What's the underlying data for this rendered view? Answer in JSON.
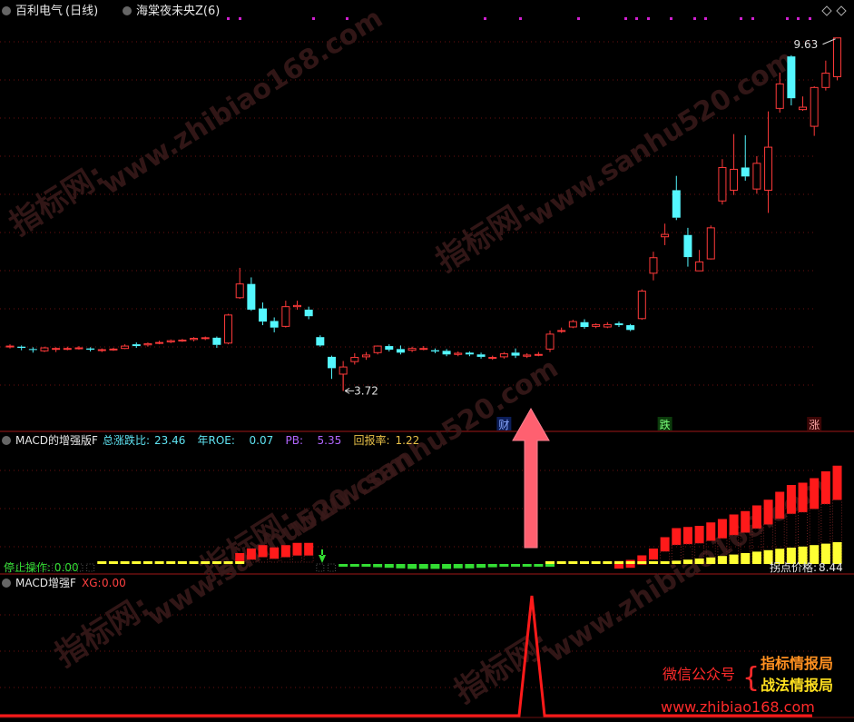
{
  "panel1": {
    "stock_name": "百利电气",
    "period": "(日线)",
    "indicator_name": "海棠夜未央Z(6)",
    "high_label": "9.63",
    "low_label": "3.72",
    "markers": [
      "财",
      "跌",
      "涨"
    ]
  },
  "panel2": {
    "indicator_name": "MACD的增强版F",
    "stats": [
      {
        "label": "总涨跌比:",
        "value": "23.46",
        "color": "#5fe3f2"
      },
      {
        "label": "年ROE:",
        "value": "0.07",
        "color": "#5fe3f2"
      },
      {
        "label": "PB:",
        "value": "5.35",
        "color": "#b266ff"
      },
      {
        "label": "回报率:",
        "value": "1.22",
        "color": "#e8c048"
      }
    ],
    "status_text": "停止操作: 0.00",
    "turning_price_label": "拐点价格:",
    "turning_price_value": "8.44"
  },
  "panel3": {
    "indicator_name": "MACD增强F",
    "xg_label": "XG:",
    "xg_value": "0.00"
  },
  "footer": {
    "wechat_label": "微信公众号",
    "brace": "{",
    "line1": "指标情报局",
    "line2": "战法情报局",
    "url": "www.zhibiao168.com"
  },
  "colors": {
    "up": "#ff3a3a",
    "down": "#54f7ff",
    "bar_red": "#ff1a1a",
    "bar_yellow": "#ffff33",
    "bar_green": "#33dd33",
    "divider": "#a01818",
    "arrow": "#ff6070",
    "marker_dot": "#d020d0"
  },
  "chart_data": [
    {
      "type": "candlestick",
      "candles": [
        [
          4.46,
          4.47,
          4.43,
          4.5
        ],
        [
          4.46,
          4.44,
          4.4,
          4.48
        ],
        [
          4.42,
          4.41,
          4.36,
          4.45
        ],
        [
          4.39,
          4.44,
          4.37,
          4.46
        ],
        [
          4.42,
          4.43,
          4.37,
          4.45
        ],
        [
          4.43,
          4.43,
          4.4,
          4.46
        ],
        [
          4.44,
          4.44,
          4.41,
          4.47
        ],
        [
          4.43,
          4.41,
          4.38,
          4.45
        ],
        [
          4.4,
          4.41,
          4.37,
          4.43
        ],
        [
          4.41,
          4.42,
          4.39,
          4.44
        ],
        [
          4.43,
          4.47,
          4.42,
          4.5
        ],
        [
          4.5,
          4.47,
          4.44,
          4.53
        ],
        [
          4.49,
          4.51,
          4.46,
          4.53
        ],
        [
          4.52,
          4.53,
          4.5,
          4.56
        ],
        [
          4.54,
          4.56,
          4.52,
          4.58
        ],
        [
          4.57,
          4.57,
          4.54,
          4.59
        ],
        [
          4.58,
          4.6,
          4.55,
          4.62
        ],
        [
          4.6,
          4.61,
          4.57,
          4.63
        ],
        [
          4.61,
          4.49,
          4.44,
          4.63
        ],
        [
          4.52,
          4.99,
          4.5,
          5.01
        ],
        [
          5.28,
          5.51,
          5.26,
          5.78
        ],
        [
          5.51,
          5.08,
          5.06,
          5.62
        ],
        [
          5.1,
          4.88,
          4.82,
          5.2
        ],
        [
          4.89,
          4.78,
          4.7,
          4.95
        ],
        [
          4.8,
          5.13,
          4.78,
          5.23
        ],
        [
          5.13,
          5.15,
          5.08,
          5.23
        ],
        [
          5.08,
          4.97,
          4.92,
          5.13
        ],
        [
          4.62,
          4.48,
          4.46,
          4.65
        ],
        [
          4.29,
          4.1,
          3.92,
          4.31
        ],
        [
          4.0,
          4.12,
          3.72,
          4.22
        ],
        [
          4.21,
          4.28,
          4.16,
          4.35
        ],
        [
          4.29,
          4.32,
          4.24,
          4.37
        ],
        [
          4.36,
          4.47,
          4.33,
          4.48
        ],
        [
          4.47,
          4.41,
          4.38,
          4.5
        ],
        [
          4.42,
          4.36,
          4.33,
          4.48
        ],
        [
          4.4,
          4.43,
          4.37,
          4.46
        ],
        [
          4.43,
          4.43,
          4.4,
          4.47
        ],
        [
          4.4,
          4.38,
          4.35,
          4.43
        ],
        [
          4.39,
          4.33,
          4.3,
          4.42
        ],
        [
          4.33,
          4.35,
          4.3,
          4.38
        ],
        [
          4.36,
          4.33,
          4.3,
          4.38
        ],
        [
          4.33,
          4.29,
          4.26,
          4.36
        ],
        [
          4.28,
          4.28,
          4.24,
          4.31
        ],
        [
          4.29,
          4.34,
          4.26,
          4.37
        ],
        [
          4.36,
          4.31,
          4.27,
          4.43
        ],
        [
          4.3,
          4.32,
          4.27,
          4.35
        ],
        [
          4.33,
          4.33,
          4.3,
          4.37
        ],
        [
          4.42,
          4.67,
          4.37,
          4.73
        ],
        [
          4.72,
          4.73,
          4.69,
          4.78
        ],
        [
          4.79,
          4.88,
          4.77,
          4.91
        ],
        [
          4.87,
          4.79,
          4.76,
          4.92
        ],
        [
          4.8,
          4.83,
          4.77,
          4.85
        ],
        [
          4.79,
          4.83,
          4.77,
          4.87
        ],
        [
          4.85,
          4.82,
          4.79,
          4.88
        ],
        [
          4.82,
          4.74,
          4.72,
          4.84
        ],
        [
          4.93,
          5.39,
          4.91,
          5.42
        ],
        [
          5.69,
          5.95,
          5.57,
          6.05
        ],
        [
          6.3,
          6.34,
          6.16,
          6.52
        ],
        [
          7.08,
          6.62,
          6.58,
          7.32
        ],
        [
          6.33,
          5.96,
          5.8,
          6.45
        ],
        [
          5.73,
          5.88,
          5.81,
          6.08
        ],
        [
          5.93,
          6.45,
          5.92,
          6.49
        ],
        [
          6.9,
          7.46,
          6.84,
          7.6
        ],
        [
          7.08,
          7.43,
          7.0,
          8.02
        ],
        [
          7.46,
          7.31,
          7.24,
          8.0
        ],
        [
          7.1,
          7.53,
          7.02,
          7.65
        ],
        [
          7.08,
          7.8,
          6.7,
          8.4
        ],
        [
          8.45,
          8.86,
          8.38,
          9.05
        ],
        [
          9.32,
          8.62,
          8.5,
          9.34
        ],
        [
          8.43,
          8.47,
          8.41,
          8.65
        ],
        [
          8.15,
          8.8,
          7.99,
          8.82
        ],
        [
          8.8,
          9.04,
          8.75,
          9.25
        ],
        [
          8.98,
          9.63,
          8.92,
          9.63
        ]
      ],
      "ylim": [
        3.3,
        9.9
      ],
      "annotations": [
        {
          "text": "9.63",
          "candle": 72,
          "price": 9.63
        },
        {
          "text": "3.72",
          "candle": 29,
          "price": 3.72
        },
        {
          "text": "财",
          "candle": 43
        },
        {
          "text": "跌",
          "candle": 57
        },
        {
          "text": "涨",
          "candle": 70
        }
      ]
    },
    {
      "type": "bar",
      "series": [
        {
          "name": "red_bars",
          "values": [
            0,
            0,
            0,
            0,
            0,
            0,
            0,
            0,
            0,
            0,
            0,
            0,
            0,
            0,
            0,
            0,
            0,
            0,
            0,
            0,
            0.08,
            0.12,
            0.15,
            0.13,
            0.15,
            0.17,
            0.17,
            0,
            0,
            0,
            0,
            0,
            0,
            0,
            0,
            0,
            0,
            0,
            0,
            0,
            0,
            0,
            0,
            0,
            0,
            0,
            0,
            0,
            0,
            0,
            0,
            0,
            0,
            0.01,
            0.02,
            0.06,
            0.12,
            0.22,
            0.3,
            0.31,
            0.32,
            0.35,
            0.38,
            0.42,
            0.45,
            0.5,
            0.55,
            0.62,
            0.68,
            0.7,
            0.74,
            0.8,
            0.85,
            0.95
          ]
        },
        {
          "name": "yellow_bars",
          "values": [
            0,
            0,
            0,
            0,
            0,
            0,
            0,
            0,
            0.02,
            0.02,
            0.02,
            0.02,
            0.02,
            0.02,
            0.02,
            0.02,
            0.02,
            0.02,
            0.02,
            0.02,
            0.02,
            0,
            0,
            0,
            0,
            0,
            0,
            0,
            0,
            0,
            0,
            0,
            0,
            0,
            0,
            0,
            0,
            0,
            0,
            0,
            0,
            0,
            0,
            0,
            0,
            0,
            0,
            0.01,
            0.01,
            0.01,
            0.01,
            0.01,
            0.02,
            0.02,
            0.03,
            0.04,
            0.05,
            0.07,
            0.09,
            0.12,
            0.15,
            0.18,
            0.22,
            0.26,
            0.3,
            0.34,
            0.38,
            0.42,
            0.45,
            0.48,
            0.52,
            0.56,
            0.6,
            0.65
          ]
        },
        {
          "name": "green_bars",
          "values": [
            0,
            0,
            0,
            0,
            0,
            0,
            0,
            0,
            0,
            0,
            0,
            0,
            0,
            0,
            0,
            0,
            0,
            0,
            0,
            0,
            0,
            0,
            0,
            0,
            0,
            0,
            0,
            0,
            0,
            0.01,
            0.02,
            0.04,
            0.06,
            0.07,
            0.08,
            0.09,
            0.09,
            0.09,
            0.09,
            0.08,
            0.08,
            0.07,
            0.06,
            0.05,
            0.04,
            0.03,
            0.02,
            0.01,
            0,
            0,
            0,
            0,
            0,
            0,
            0,
            0,
            0,
            0,
            0,
            0,
            0,
            0,
            0,
            0,
            0,
            0,
            0,
            0,
            0,
            0,
            0,
            0,
            0,
            0,
            0,
            0
          ]
        }
      ]
    },
    {
      "type": "line",
      "series": [
        {
          "values": [
            0,
            0,
            0,
            0,
            0,
            0,
            0,
            0,
            0,
            0,
            0,
            0,
            0,
            0,
            0,
            0,
            0,
            0,
            0,
            0,
            0,
            0,
            0,
            0,
            0,
            0,
            0,
            0,
            0,
            0,
            0,
            0,
            0,
            0,
            0,
            0,
            0,
            0,
            0,
            0,
            0,
            0,
            0,
            0,
            0,
            0,
            0,
            0,
            0,
            1,
            0,
            0,
            0,
            0,
            0,
            0,
            0,
            0,
            0,
            0,
            0,
            0,
            0,
            0,
            0,
            0,
            0,
            0,
            0,
            0,
            0,
            0,
            0,
            0,
            0
          ]
        }
      ],
      "ylim": [
        0,
        1
      ]
    }
  ]
}
